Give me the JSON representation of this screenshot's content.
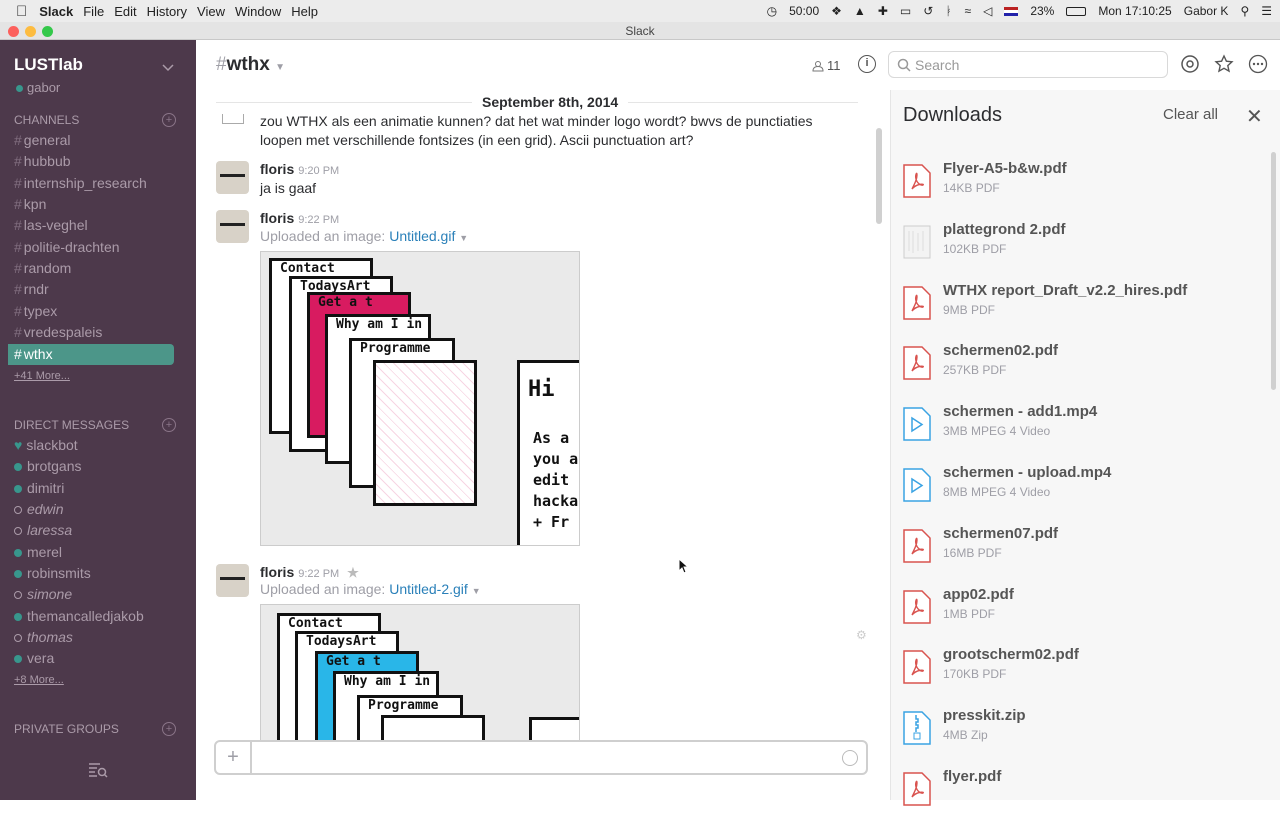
{
  "menubar": {
    "app": "Slack",
    "items": [
      "File",
      "Edit",
      "History",
      "View",
      "Window",
      "Help"
    ],
    "battery_timer": "50:00",
    "battery": "23%",
    "clock": "Mon 17:10:25",
    "user": "Gabor K"
  },
  "window": {
    "title": "Slack"
  },
  "sidebar": {
    "team": "LUSTlab",
    "user": "gabor",
    "channels_header": "CHANNELS",
    "channels": [
      "general",
      "hubbub",
      "internship_research",
      "kpn",
      "las-veghel",
      "politie-drachten",
      "random",
      "rndr",
      "typex",
      "vredespaleis",
      "wthx"
    ],
    "active_channel": "wthx",
    "channels_more": "+41 More...",
    "dm_header": "DIRECT MESSAGES",
    "dms": [
      {
        "name": "slackbot",
        "status": "heart"
      },
      {
        "name": "brotgans",
        "status": "online"
      },
      {
        "name": "dimitri",
        "status": "online"
      },
      {
        "name": "edwin",
        "status": "away"
      },
      {
        "name": "laressa",
        "status": "away"
      },
      {
        "name": "merel",
        "status": "online"
      },
      {
        "name": "robinsmits",
        "status": "online"
      },
      {
        "name": "simone",
        "status": "away"
      },
      {
        "name": "themancalledjakob",
        "status": "online"
      },
      {
        "name": "thomas",
        "status": "away"
      },
      {
        "name": "vera",
        "status": "online"
      }
    ],
    "dms_more": "+8 More...",
    "groups_header": "PRIVATE GROUPS"
  },
  "header": {
    "hash": "#",
    "channel": "wthx",
    "members": "11",
    "search_placeholder": "Search"
  },
  "messages": {
    "date": "September 8th, 2014",
    "partial_text": "zou WTHX als een animatie kunnen? dat het wat minder logo wordt? bwvs de punctiaties loopen met verschillende fontsizes (in een grid). Ascii punctuation art?",
    "items": [
      {
        "author": "floris",
        "time": "9:20 PM",
        "text": "ja is gaaf"
      },
      {
        "author": "floris",
        "time": "9:22 PM",
        "upload_prefix": "Uploaded an image:",
        "file": "Untitled.gif"
      },
      {
        "author": "floris",
        "time": "9:22 PM",
        "upload_prefix": "Uploaded an image:",
        "file": "Untitled-2.gif"
      }
    ],
    "gif1_cards": [
      "Contact",
      "TodaysArt",
      "Get a t",
      "Why am I in",
      "Programme",
      "Hi",
      "As a you a edit hacka + Fr"
    ],
    "gif2_cards": [
      "Contact",
      "TodaysArt",
      "Get a t",
      "Why am I in",
      "Programme"
    ]
  },
  "downloads": {
    "title": "Downloads",
    "clear": "Clear all",
    "files": [
      {
        "name": "Flyer-A5-b&w.pdf",
        "size": "14KB PDF",
        "kind": "pdf"
      },
      {
        "name": "plattegrond 2.pdf",
        "size": "102KB PDF",
        "kind": "thumb"
      },
      {
        "name": "WTHX report_Draft_v2.2_hires.pdf",
        "size": "9MB PDF",
        "kind": "pdf"
      },
      {
        "name": "schermen02.pdf",
        "size": "257KB PDF",
        "kind": "pdf"
      },
      {
        "name": "schermen - add1.mp4",
        "size": "3MB MPEG 4 Video",
        "kind": "video"
      },
      {
        "name": "schermen - upload.mp4",
        "size": "8MB MPEG 4 Video",
        "kind": "video"
      },
      {
        "name": "schermen07.pdf",
        "size": "16MB PDF",
        "kind": "pdf"
      },
      {
        "name": "app02.pdf",
        "size": "1MB PDF",
        "kind": "pdf"
      },
      {
        "name": "grootscherm02.pdf",
        "size": "170KB PDF",
        "kind": "pdf"
      },
      {
        "name": "presskit.zip",
        "size": "4MB Zip",
        "kind": "zip"
      },
      {
        "name": "flyer.pdf",
        "size": "",
        "kind": "pdf"
      }
    ]
  },
  "colors": {
    "sidebar": "#4d394b",
    "active": "#4c9689",
    "presence": "#38978d",
    "link": "#2a80b9",
    "pdf": "#d9534f",
    "video": "#3aa3e3"
  }
}
